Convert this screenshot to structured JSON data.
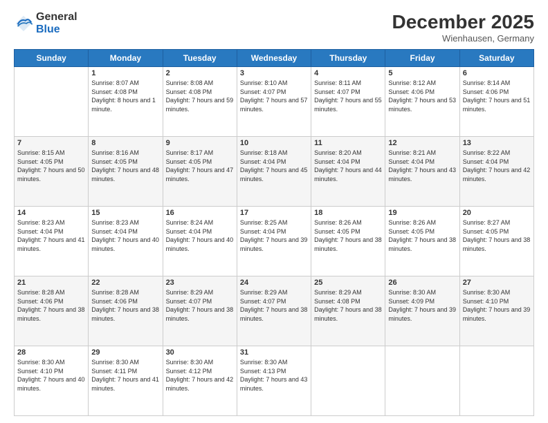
{
  "header": {
    "logo_general": "General",
    "logo_blue": "Blue",
    "month_title": "December 2025",
    "subtitle": "Wienhausen, Germany"
  },
  "days_of_week": [
    "Sunday",
    "Monday",
    "Tuesday",
    "Wednesday",
    "Thursday",
    "Friday",
    "Saturday"
  ],
  "weeks": [
    [
      {
        "num": "",
        "sunrise": "",
        "sunset": "",
        "daylight": ""
      },
      {
        "num": "1",
        "sunrise": "Sunrise: 8:07 AM",
        "sunset": "Sunset: 4:08 PM",
        "daylight": "Daylight: 8 hours and 1 minute."
      },
      {
        "num": "2",
        "sunrise": "Sunrise: 8:08 AM",
        "sunset": "Sunset: 4:08 PM",
        "daylight": "Daylight: 7 hours and 59 minutes."
      },
      {
        "num": "3",
        "sunrise": "Sunrise: 8:10 AM",
        "sunset": "Sunset: 4:07 PM",
        "daylight": "Daylight: 7 hours and 57 minutes."
      },
      {
        "num": "4",
        "sunrise": "Sunrise: 8:11 AM",
        "sunset": "Sunset: 4:07 PM",
        "daylight": "Daylight: 7 hours and 55 minutes."
      },
      {
        "num": "5",
        "sunrise": "Sunrise: 8:12 AM",
        "sunset": "Sunset: 4:06 PM",
        "daylight": "Daylight: 7 hours and 53 minutes."
      },
      {
        "num": "6",
        "sunrise": "Sunrise: 8:14 AM",
        "sunset": "Sunset: 4:06 PM",
        "daylight": "Daylight: 7 hours and 51 minutes."
      }
    ],
    [
      {
        "num": "7",
        "sunrise": "Sunrise: 8:15 AM",
        "sunset": "Sunset: 4:05 PM",
        "daylight": "Daylight: 7 hours and 50 minutes."
      },
      {
        "num": "8",
        "sunrise": "Sunrise: 8:16 AM",
        "sunset": "Sunset: 4:05 PM",
        "daylight": "Daylight: 7 hours and 48 minutes."
      },
      {
        "num": "9",
        "sunrise": "Sunrise: 8:17 AM",
        "sunset": "Sunset: 4:05 PM",
        "daylight": "Daylight: 7 hours and 47 minutes."
      },
      {
        "num": "10",
        "sunrise": "Sunrise: 8:18 AM",
        "sunset": "Sunset: 4:04 PM",
        "daylight": "Daylight: 7 hours and 45 minutes."
      },
      {
        "num": "11",
        "sunrise": "Sunrise: 8:20 AM",
        "sunset": "Sunset: 4:04 PM",
        "daylight": "Daylight: 7 hours and 44 minutes."
      },
      {
        "num": "12",
        "sunrise": "Sunrise: 8:21 AM",
        "sunset": "Sunset: 4:04 PM",
        "daylight": "Daylight: 7 hours and 43 minutes."
      },
      {
        "num": "13",
        "sunrise": "Sunrise: 8:22 AM",
        "sunset": "Sunset: 4:04 PM",
        "daylight": "Daylight: 7 hours and 42 minutes."
      }
    ],
    [
      {
        "num": "14",
        "sunrise": "Sunrise: 8:23 AM",
        "sunset": "Sunset: 4:04 PM",
        "daylight": "Daylight: 7 hours and 41 minutes."
      },
      {
        "num": "15",
        "sunrise": "Sunrise: 8:23 AM",
        "sunset": "Sunset: 4:04 PM",
        "daylight": "Daylight: 7 hours and 40 minutes."
      },
      {
        "num": "16",
        "sunrise": "Sunrise: 8:24 AM",
        "sunset": "Sunset: 4:04 PM",
        "daylight": "Daylight: 7 hours and 40 minutes."
      },
      {
        "num": "17",
        "sunrise": "Sunrise: 8:25 AM",
        "sunset": "Sunset: 4:04 PM",
        "daylight": "Daylight: 7 hours and 39 minutes."
      },
      {
        "num": "18",
        "sunrise": "Sunrise: 8:26 AM",
        "sunset": "Sunset: 4:05 PM",
        "daylight": "Daylight: 7 hours and 38 minutes."
      },
      {
        "num": "19",
        "sunrise": "Sunrise: 8:26 AM",
        "sunset": "Sunset: 4:05 PM",
        "daylight": "Daylight: 7 hours and 38 minutes."
      },
      {
        "num": "20",
        "sunrise": "Sunrise: 8:27 AM",
        "sunset": "Sunset: 4:05 PM",
        "daylight": "Daylight: 7 hours and 38 minutes."
      }
    ],
    [
      {
        "num": "21",
        "sunrise": "Sunrise: 8:28 AM",
        "sunset": "Sunset: 4:06 PM",
        "daylight": "Daylight: 7 hours and 38 minutes."
      },
      {
        "num": "22",
        "sunrise": "Sunrise: 8:28 AM",
        "sunset": "Sunset: 4:06 PM",
        "daylight": "Daylight: 7 hours and 38 minutes."
      },
      {
        "num": "23",
        "sunrise": "Sunrise: 8:29 AM",
        "sunset": "Sunset: 4:07 PM",
        "daylight": "Daylight: 7 hours and 38 minutes."
      },
      {
        "num": "24",
        "sunrise": "Sunrise: 8:29 AM",
        "sunset": "Sunset: 4:07 PM",
        "daylight": "Daylight: 7 hours and 38 minutes."
      },
      {
        "num": "25",
        "sunrise": "Sunrise: 8:29 AM",
        "sunset": "Sunset: 4:08 PM",
        "daylight": "Daylight: 7 hours and 38 minutes."
      },
      {
        "num": "26",
        "sunrise": "Sunrise: 8:30 AM",
        "sunset": "Sunset: 4:09 PM",
        "daylight": "Daylight: 7 hours and 39 minutes."
      },
      {
        "num": "27",
        "sunrise": "Sunrise: 8:30 AM",
        "sunset": "Sunset: 4:10 PM",
        "daylight": "Daylight: 7 hours and 39 minutes."
      }
    ],
    [
      {
        "num": "28",
        "sunrise": "Sunrise: 8:30 AM",
        "sunset": "Sunset: 4:10 PM",
        "daylight": "Daylight: 7 hours and 40 minutes."
      },
      {
        "num": "29",
        "sunrise": "Sunrise: 8:30 AM",
        "sunset": "Sunset: 4:11 PM",
        "daylight": "Daylight: 7 hours and 41 minutes."
      },
      {
        "num": "30",
        "sunrise": "Sunrise: 8:30 AM",
        "sunset": "Sunset: 4:12 PM",
        "daylight": "Daylight: 7 hours and 42 minutes."
      },
      {
        "num": "31",
        "sunrise": "Sunrise: 8:30 AM",
        "sunset": "Sunset: 4:13 PM",
        "daylight": "Daylight: 7 hours and 43 minutes."
      },
      {
        "num": "",
        "sunrise": "",
        "sunset": "",
        "daylight": ""
      },
      {
        "num": "",
        "sunrise": "",
        "sunset": "",
        "daylight": ""
      },
      {
        "num": "",
        "sunrise": "",
        "sunset": "",
        "daylight": ""
      }
    ]
  ]
}
